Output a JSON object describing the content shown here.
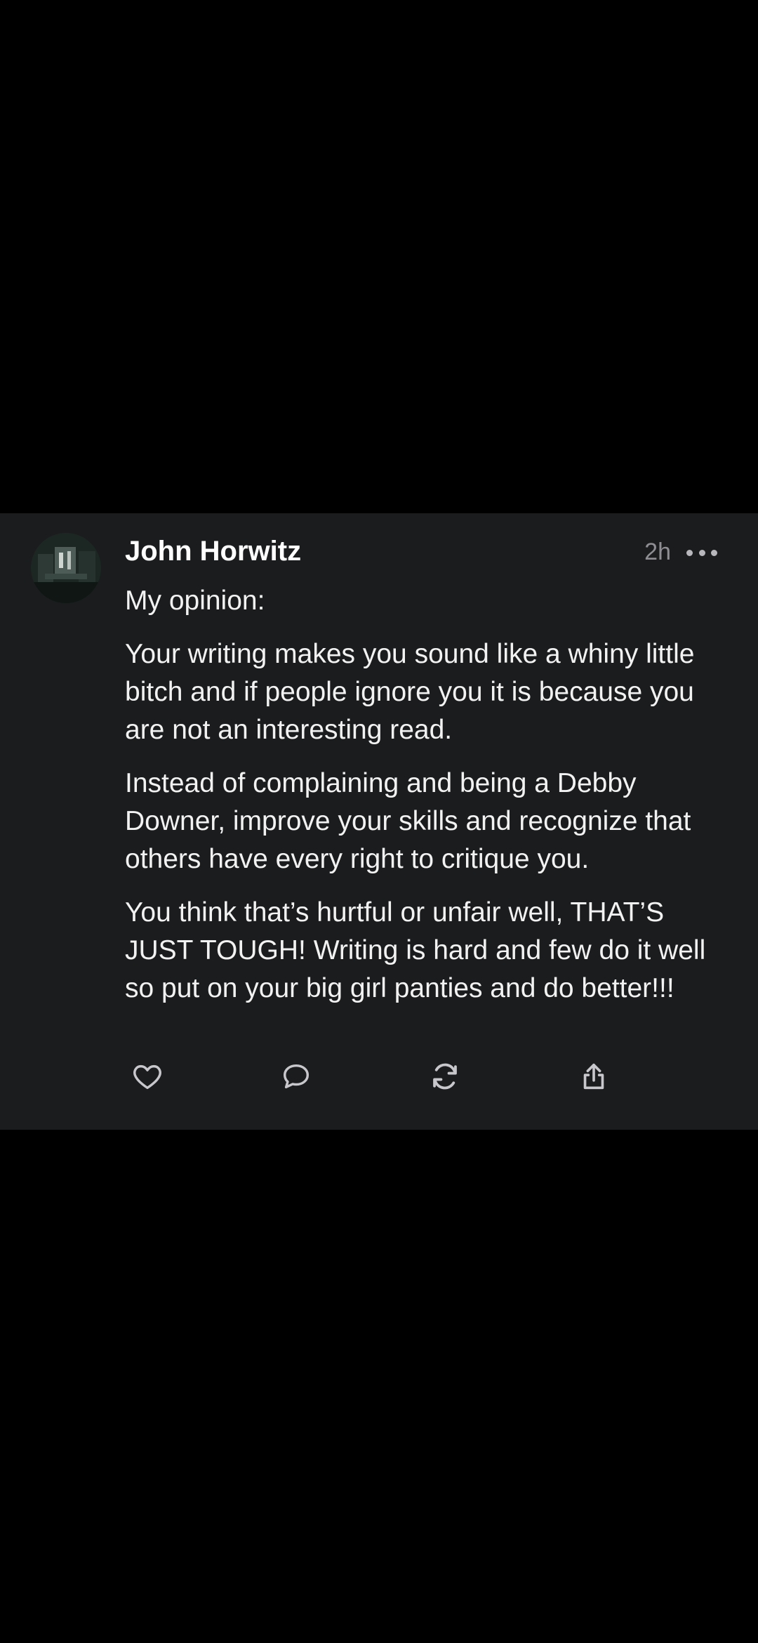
{
  "post": {
    "author": "John Horwitz",
    "time": "2h",
    "paragraphs": [
      "My opinion:",
      "Your writing makes you sound like a whiny little bitch and if people ignore you it is because you are not an interesting read.",
      "Instead of complaining and being a Debby Downer, improve your skills and recognize that others have every right to critique you.",
      "You think that’s hurtful or unfair well, THAT’S JUST TOUGH! Writing is hard and few do it well so put on your big girl panties and do better!!!"
    ]
  },
  "actions": {
    "like": "heart-icon",
    "reply": "comment-icon",
    "repost": "repost-icon",
    "share": "share-icon"
  },
  "colors": {
    "background": "#000000",
    "card": "#1b1c1e",
    "text": "#f2f2f2",
    "muted": "#8e8e93"
  }
}
